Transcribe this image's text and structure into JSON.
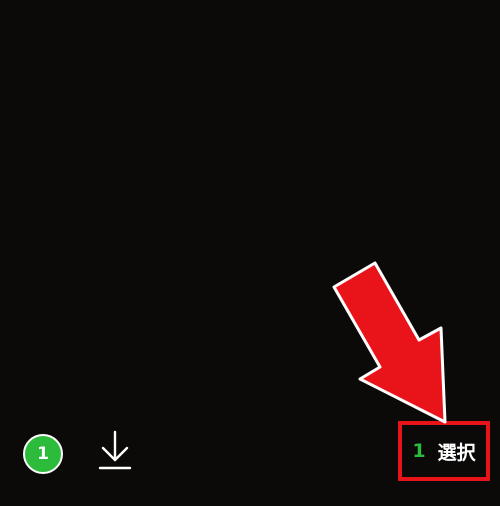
{
  "toolbar": {
    "selected_count_badge": "1",
    "download_icon": "download-icon",
    "select_count": "1",
    "select_label": "選択"
  },
  "colors": {
    "background": "#0b0a09",
    "badge_green": "#2dbb3b",
    "annotation_red": "#e8141a",
    "icon_white": "#ffffff"
  },
  "annotation": {
    "type": "red-arrow-pointing-down-right"
  }
}
